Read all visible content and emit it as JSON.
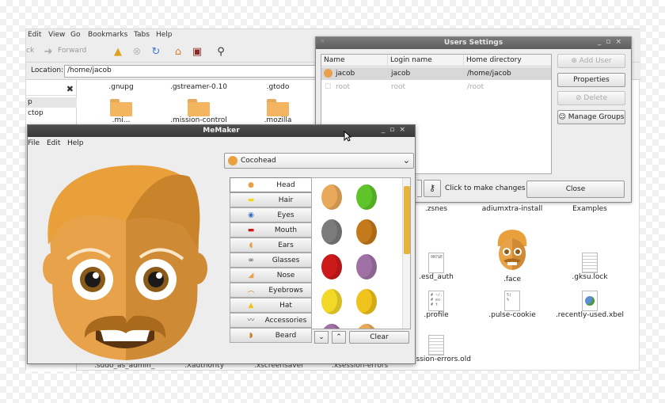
{
  "file_manager": {
    "menu": [
      "Edit",
      "View",
      "Go",
      "Bookmarks",
      "Tabs",
      "Help"
    ],
    "toolbar": {
      "back_label": "ck",
      "forward_label": "Forward"
    },
    "location_label": "Location:",
    "location_value": "/home/jacob",
    "sidebar_items": [
      "p",
      "ctop"
    ],
    "items_top": [
      ".gnupg",
      ".gstreamer-0.10",
      ".gtodo"
    ],
    "items_partial": [
      ".mi...",
      ".mission-control",
      ".mozilla"
    ],
    "items_right": [
      {
        "label": ".zsnes",
        "icon": "none"
      },
      {
        "label": "adiumxtra-install",
        "icon": "none"
      },
      {
        "label": "Examples",
        "icon": "none"
      },
      {
        "label": ".esd_auth",
        "icon": "doc",
        "snippet": "0N7$E"
      },
      {
        "label": ".face",
        "icon": "face"
      },
      {
        "label": ".gksu.lock",
        "icon": "doc-lines"
      },
      {
        "label": ".profile",
        "icon": "doc",
        "snippet": "# ~/.\n# ex\n# t"
      },
      {
        "label": ".pulse-cookie",
        "icon": "doc",
        "snippet": "5)\n%"
      },
      {
        "label": ".recently-used.xbel",
        "icon": "globe"
      },
      {
        "label": ".xsession-errors.old",
        "icon": "doc-lines"
      }
    ],
    "items_bottom_cut": [
      ".sudo_as_admin_",
      ".Xauthority",
      ".xscreensaver",
      ".xsession-errors"
    ]
  },
  "users_settings": {
    "title": "Users Settings",
    "columns": [
      "Name",
      "Login name",
      "Home directory"
    ],
    "rows": [
      {
        "name": "jacob",
        "login": "jacob",
        "home": "/home/jacob",
        "selected": true
      },
      {
        "name": "root",
        "login": "root",
        "home": "/root",
        "selected": false
      }
    ],
    "buttons": {
      "add_user": "Add User",
      "properties": "Properties",
      "delete": "Delete",
      "manage_groups": "Manage Groups"
    },
    "lock_text": "Click to make changes",
    "close_label": "Close"
  },
  "memaker": {
    "title": "MeMaker",
    "menu": [
      "File",
      "Edit",
      "Help"
    ],
    "preset": "Cocohead",
    "categories": [
      {
        "label": "Head",
        "icon": "head-icon"
      },
      {
        "label": "Hair",
        "icon": "hair-icon"
      },
      {
        "label": "Eyes",
        "icon": "eyes-icon"
      },
      {
        "label": "Mouth",
        "icon": "mouth-icon"
      },
      {
        "label": "Ears",
        "icon": "ears-icon"
      },
      {
        "label": "Glasses",
        "icon": "glasses-icon"
      },
      {
        "label": "Nose",
        "icon": "nose-icon"
      },
      {
        "label": "Eyebrows",
        "icon": "eyebrows-icon"
      },
      {
        "label": "Hat",
        "icon": "hat-icon"
      },
      {
        "label": "Accessories",
        "icon": "accessories-icon"
      },
      {
        "label": "Beard",
        "icon": "beard-icon"
      }
    ],
    "selected_category": "Head",
    "swatch_colors": [
      "#e9a95a",
      "#5fc42a",
      "#7b7b7b",
      "#c4791a",
      "#cc1a1a",
      "#a071a5",
      "#f2d827",
      "#f0c21c",
      "#a071a5",
      "#e9a95a"
    ],
    "clear_label": "Clear",
    "colors": {
      "face": "#e8a24a",
      "face_shade": "#cf8a36",
      "hair": "#e9a03b",
      "hair_dark": "#c9832a",
      "mustache": "#a96a1e",
      "eye_iris": "#8a5a18"
    }
  }
}
